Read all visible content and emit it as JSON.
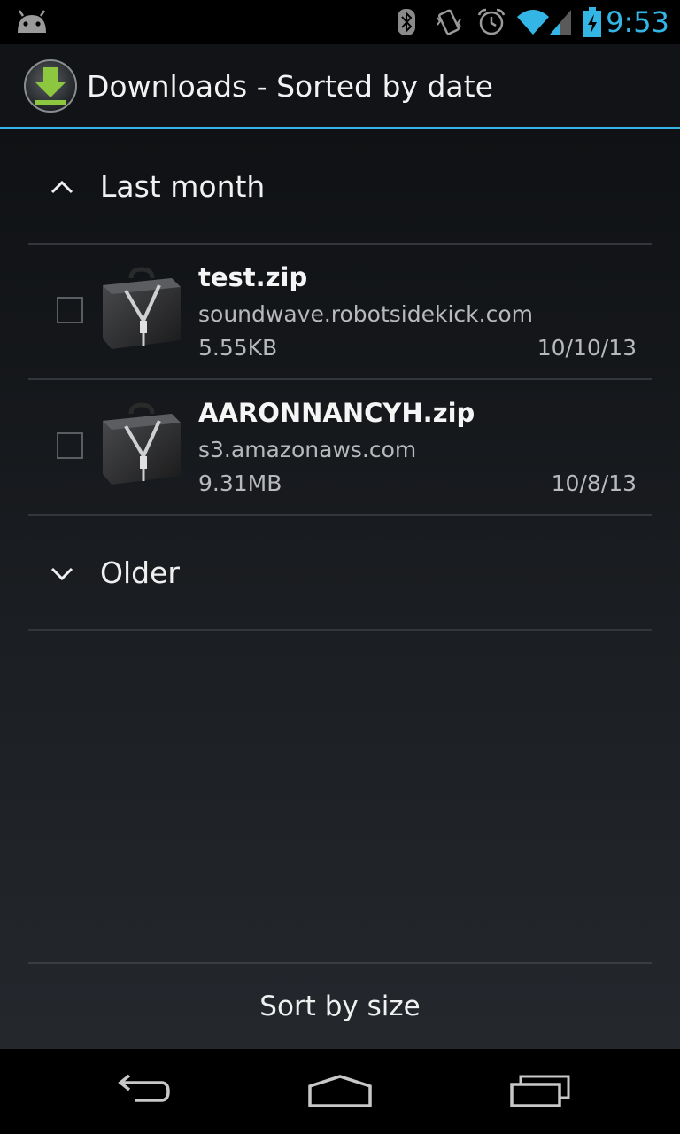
{
  "status_bar": {
    "time": "9:53",
    "icons": [
      "android-icon",
      "bluetooth-icon",
      "vibrate-icon",
      "alarm-icon",
      "wifi-icon",
      "signal-icon",
      "battery-charging-icon"
    ]
  },
  "action_bar": {
    "title": "Downloads - Sorted by date",
    "icon": "download-icon"
  },
  "groups": [
    {
      "label": "Last month",
      "expanded": true,
      "items": [
        {
          "name": "test.zip",
          "source": "soundwave.robotsidekick.com",
          "size": "5.55KB",
          "date": "10/10/13",
          "checked": false,
          "icon": "zip-briefcase-icon"
        },
        {
          "name": "AARONNANCYH.zip",
          "source": "s3.amazonaws.com",
          "size": "9.31MB",
          "date": "10/8/13",
          "checked": false,
          "icon": "zip-briefcase-icon"
        }
      ]
    },
    {
      "label": "Older",
      "expanded": false,
      "items": []
    }
  ],
  "footer": {
    "sort_label": "Sort by size"
  },
  "nav_bar": {
    "buttons": [
      "back-icon",
      "home-icon",
      "recents-icon"
    ]
  },
  "colors": {
    "accent": "#33b5e5",
    "background": "#1b1e22"
  }
}
